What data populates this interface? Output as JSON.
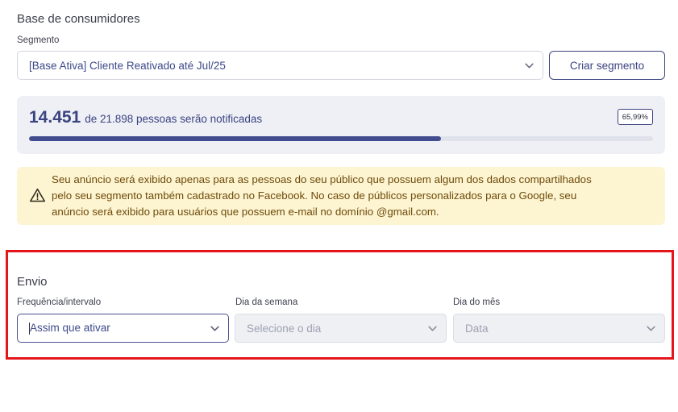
{
  "consumer_base": {
    "title": "Base de consumidores",
    "segment_label": "Segmento",
    "segment_value": "[Base Ativa] Cliente Reativado até Jul/25",
    "create_segment_button": "Criar segmento"
  },
  "reach": {
    "count": "14.451",
    "rest_text": "de 21.898 pessoas serão notificadas",
    "percent_label": "65,99%",
    "progress_fraction": 0.6599
  },
  "alert": {
    "icon": "warning-triangle-icon",
    "lines": [
      "Seu anúncio será exibido apenas para as pessoas do seu público que possuem algum dos dados compartilhados",
      "pelo seu segmento também cadastrado no Facebook. No caso de públicos personalizados para o Google, seu",
      "anúncio será exibido para usuários que possuem e-mail no domínio @gmail.com."
    ]
  },
  "envio": {
    "title": "Envio",
    "frequency": {
      "label": "Frequência/intervalo",
      "value": "Assim que ativar"
    },
    "weekday": {
      "label": "Dia da semana",
      "placeholder": "Selecione o dia"
    },
    "month_day": {
      "label": "Dia do mês",
      "placeholder": "Data"
    }
  },
  "colors": {
    "accent": "#3b4380",
    "progress": "#434c8f",
    "alert_bg": "#fdf4d2",
    "alert_text": "#6e4b09",
    "highlight": "#e3161b"
  }
}
